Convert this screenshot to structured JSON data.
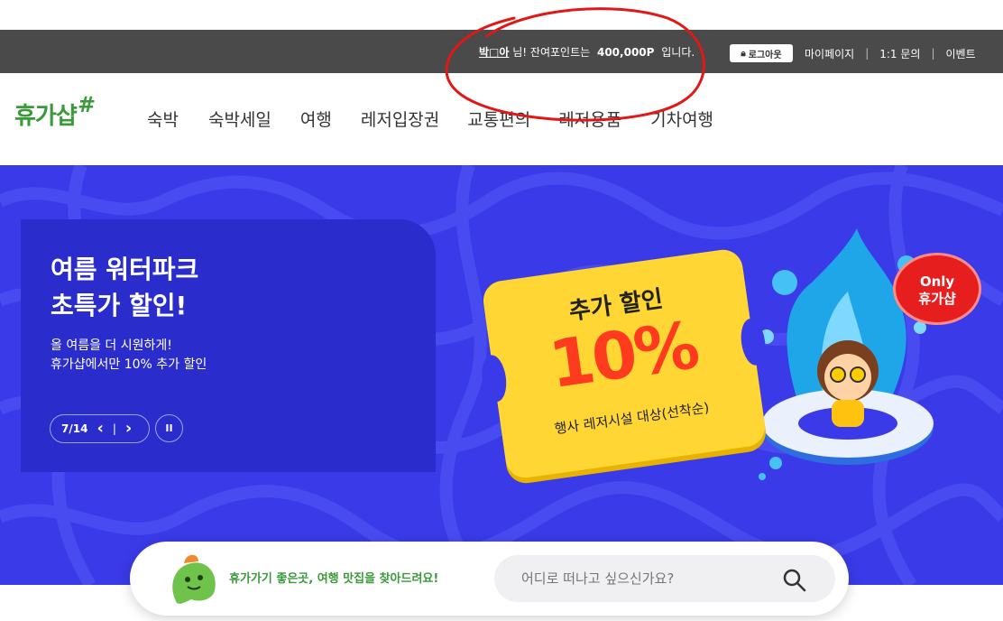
{
  "topbar": {
    "user_name": "박□아",
    "welcome_suffix": "님! 잔여포인트는",
    "points": "400,000P",
    "points_suffix": "입니다.",
    "logout_label": "로그아웃",
    "links": [
      "마이페이지",
      "1:1 문의",
      "이벤트"
    ]
  },
  "header": {
    "logo_text": "휴가샵",
    "logo_mark": "#",
    "nav": [
      "숙박",
      "숙박세일",
      "여행",
      "레저입장권",
      "교통편의",
      "레저용품",
      "기차여행"
    ]
  },
  "hero": {
    "title_line1": "여름 워터파크",
    "title_line2": "초특가 할인!",
    "sub_line1": "올 여름을 더 시원하게!",
    "sub_line2": "휴가샵에서만 10% 추가 할인",
    "pager": "7/14",
    "prev": "‹",
    "next": "›",
    "pause": "II",
    "ticket_top": "추가 할인",
    "ticket_big": "10%",
    "ticket_bottom": "행사 레저시설 대상(선착순)",
    "badge_line1": "Only",
    "badge_line2": "휴가샵"
  },
  "search": {
    "tagline": "휴가가기 좋은곳, 여행 맛집을 찾아드려요!",
    "placeholder": "어디로 떠나고 싶으신가요?"
  },
  "colors": {
    "topbar": "#4a4a4a",
    "hero_bg": "#3a3ae8",
    "hero_card": "#2a2dcc",
    "brand_green": "#3a9a3a",
    "ticket_yellow": "#ffd633",
    "accent_red": "#e61e1e"
  }
}
